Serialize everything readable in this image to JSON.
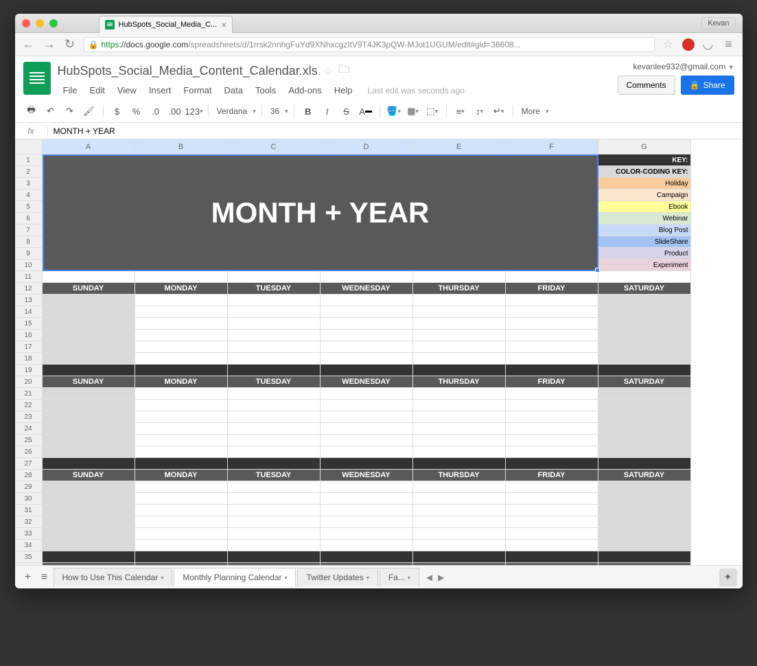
{
  "browser": {
    "tab_title": "HubSpots_Social_Media_C...",
    "user_name": "Kevan",
    "url_proto": "https",
    "url_host": "://docs.google.com",
    "url_path": "/spreadsheets/d/1rrsk2nnhgFuYd9XNhxcgzItV9T4JK3pQW-MJot1UGUM/edit#gid=36608..."
  },
  "docs": {
    "title": "HubSpots_Social_Media_Content_Calendar.xls",
    "menus": [
      "File",
      "Edit",
      "View",
      "Insert",
      "Format",
      "Data",
      "Tools",
      "Add-ons",
      "Help"
    ],
    "edit_status": "Last edit was seconds ago",
    "user_email": "kevanlee932@gmail.com",
    "comments_btn": "Comments",
    "share_btn": "Share",
    "font": "Verdana",
    "font_size": "36",
    "more": "More"
  },
  "formula": {
    "fx": "fx",
    "value": "MONTH + YEAR"
  },
  "sheet": {
    "columns": [
      "A",
      "B",
      "C",
      "D",
      "E",
      "F",
      "G"
    ],
    "merged_title": "MONTH + YEAR",
    "key_header": "KEY:",
    "color_key_header": "COLOR-CODING KEY:",
    "legend": [
      {
        "label": "Holiday",
        "color": "#f9cb9c"
      },
      {
        "label": "Campaign",
        "color": "#fce5cd"
      },
      {
        "label": "Ebook",
        "color": "#ffff99"
      },
      {
        "label": "Webinar",
        "color": "#d9ead3"
      },
      {
        "label": "Blog Post",
        "color": "#c9daf8"
      },
      {
        "label": "SlideShare",
        "color": "#a4c2f4"
      },
      {
        "label": "Product",
        "color": "#d9d2e9"
      },
      {
        "label": "Experiment",
        "color": "#ead1dc"
      }
    ],
    "days": [
      "SUNDAY",
      "MONDAY",
      "TUESDAY",
      "WEDNESDAY",
      "THURSDAY",
      "FRIDAY",
      "SATURDAY"
    ]
  },
  "tabs": {
    "items": [
      "How to Use This Calendar",
      "Monthly Planning Calendar",
      "Twitter Updates",
      "Fa..."
    ],
    "active": 1
  }
}
